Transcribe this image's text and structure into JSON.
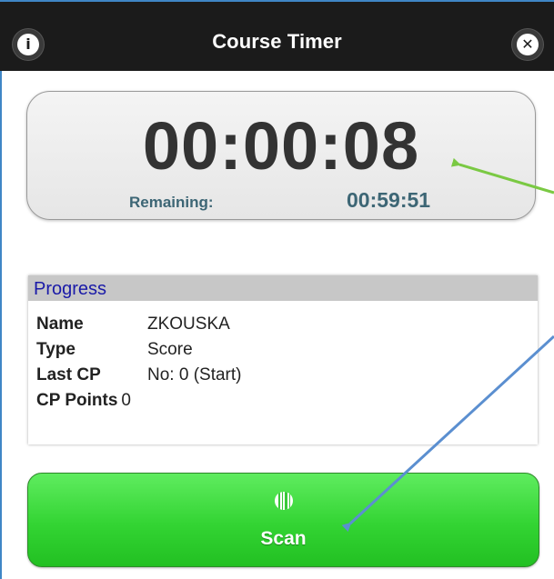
{
  "header": {
    "title": "Course Timer",
    "info_icon": "info-icon",
    "close_icon": "close-icon"
  },
  "timer": {
    "elapsed": "00:00:08",
    "remaining_label": "Remaining:",
    "remaining_value": "00:59:51"
  },
  "progress": {
    "title": "Progress",
    "rows": [
      {
        "label": "Name",
        "value": "ZKOUSKA"
      },
      {
        "label": "Type",
        "value": "Score"
      },
      {
        "label": "Last CP",
        "value": "No: 0 (Start)"
      },
      {
        "label": "CP Points",
        "value": "0"
      }
    ]
  },
  "scan_button": {
    "label": "Scan",
    "icon": "barcode-icon"
  },
  "colors": {
    "header_bg": "#1b1b1b",
    "accent_border": "#3f86c6",
    "scan_green": "#33d433",
    "remaining_text": "#3d6675",
    "progress_title": "#1a1aa8",
    "arrow_green": "#7ac943",
    "arrow_blue": "#5b8fd0"
  }
}
